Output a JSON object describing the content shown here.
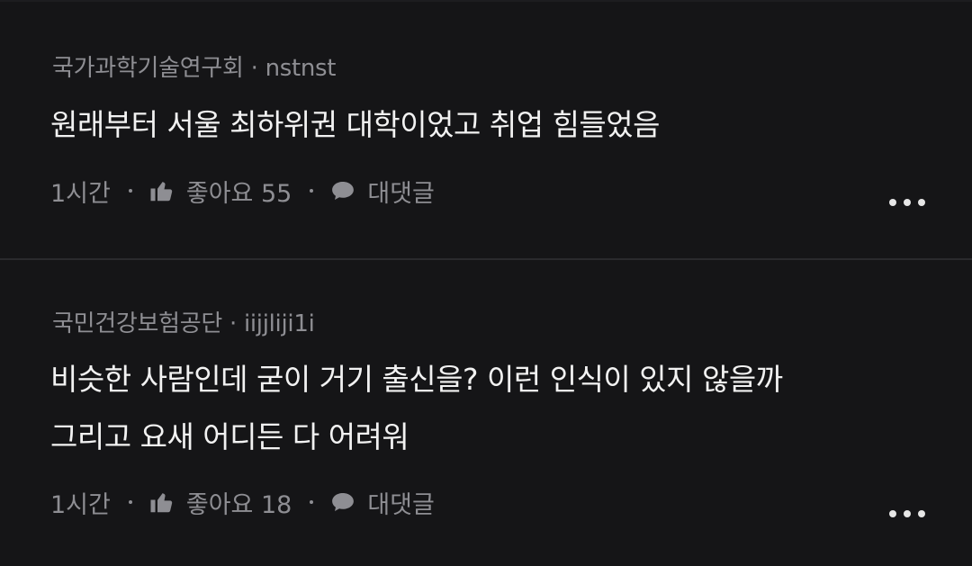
{
  "comments": [
    {
      "org": "국가과학기술연구회",
      "username": "nstnst",
      "separator": "·",
      "lines": [
        "원래부터 서울 최하위권 대학이었고 취업 힘들었음"
      ],
      "time": "1시간",
      "like_label": "좋아요 55",
      "reply_label": "대댓글"
    },
    {
      "org": "국민건강보험공단",
      "username": "iijjliji1i",
      "separator": "·",
      "lines": [
        "비슷한 사람인데 굳이 거기 출신을? 이런 인식이 있지 않을까",
        "그리고 요새 어디든 다 어려워"
      ],
      "time": "1시간",
      "like_label": "좋아요 18",
      "reply_label": "대댓글"
    }
  ],
  "icons": {
    "like": "thumbs-up-icon",
    "reply": "speech-bubble-icon",
    "more": "more-horizontal-icon"
  },
  "colors": {
    "background": "#151517",
    "text": "#f2f2f2",
    "muted": "#8e8e93"
  }
}
